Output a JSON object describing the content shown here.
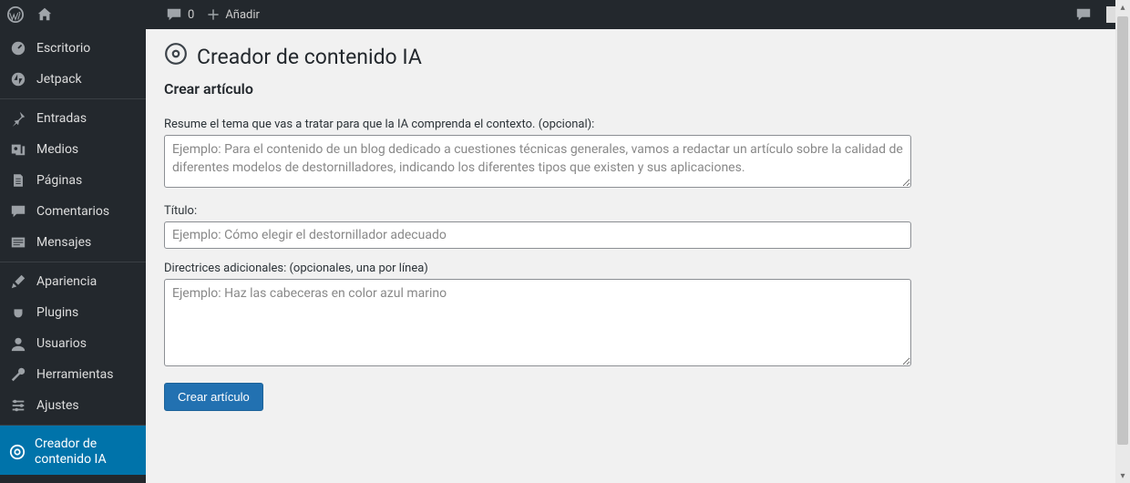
{
  "adminBar": {
    "comments_count": "0",
    "add_label": "Añadir"
  },
  "sidebar": {
    "items": [
      {
        "label": "Escritorio"
      },
      {
        "label": "Jetpack"
      },
      {
        "label": "Entradas"
      },
      {
        "label": "Medios"
      },
      {
        "label": "Páginas"
      },
      {
        "label": "Comentarios"
      },
      {
        "label": "Mensajes"
      },
      {
        "label": "Apariencia"
      },
      {
        "label": "Plugins"
      },
      {
        "label": "Usuarios"
      },
      {
        "label": "Herramientas"
      },
      {
        "label": "Ajustes"
      },
      {
        "label": "Creador de contenido IA"
      }
    ]
  },
  "page": {
    "title": "Creador de contenido IA",
    "section_heading": "Crear artículo",
    "summary_label": "Resume el tema que vas a tratar para que la IA comprenda el contexto. (opcional):",
    "summary_placeholder": "Ejemplo: Para el contenido de un blog dedicado a cuestiones técnicas generales, vamos a redactar un artículo sobre la calidad de diferentes modelos de destornilladores, indicando los diferentes tipos que existen y sus aplicaciones.",
    "title_label": "Título:",
    "title_placeholder": "Ejemplo: Cómo elegir el destornillador adecuado",
    "guidelines_label": "Directrices adicionales: (opcionales, una por línea)",
    "guidelines_placeholder": "Ejemplo: Haz las cabeceras en color azul marino",
    "submit_label": "Crear artículo"
  }
}
